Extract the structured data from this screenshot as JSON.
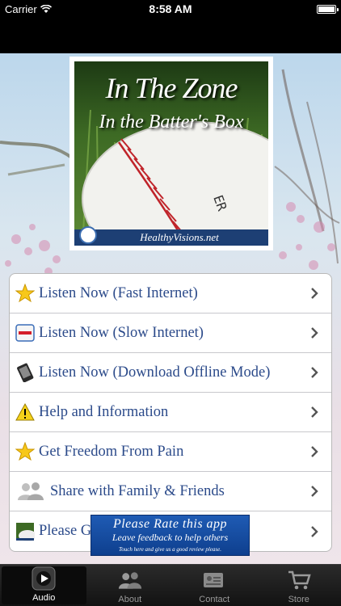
{
  "status_bar": {
    "carrier": "Carrier",
    "time": "8:58 AM",
    "battery_level": 1.0
  },
  "cover": {
    "title": "In The Zone",
    "subtitle": "In the Batter's Box",
    "footer": "HealthyVisions.net"
  },
  "menu": {
    "items": [
      {
        "label": "Listen Now (Fast Internet)",
        "icon": "star-icon"
      },
      {
        "label": "Listen Now (Slow Internet)",
        "icon": "no-entry-icon"
      },
      {
        "label": "Listen Now (Download Offline Mode)",
        "icon": "phone-icon"
      },
      {
        "label": "Help and Information",
        "icon": "warning-icon"
      },
      {
        "label": "Get Freedom From Pain",
        "icon": "star-icon"
      },
      {
        "label": "Share with Family & Friends",
        "icon": "people-icon"
      },
      {
        "label": "Please Go",
        "icon": "album-thumbnail-icon"
      }
    ]
  },
  "rate_banner": {
    "title": "Please Rate this app",
    "subtitle": "Leave feedback to help others",
    "small": "Touch here and give us a good review please."
  },
  "tab_bar": {
    "tabs": [
      {
        "label": "Audio",
        "icon": "audio-play-icon",
        "active": true
      },
      {
        "label": "About",
        "icon": "people-icon",
        "active": false
      },
      {
        "label": "Contact",
        "icon": "contact-card-icon",
        "active": false
      },
      {
        "label": "Store",
        "icon": "cart-icon",
        "active": false
      }
    ]
  }
}
